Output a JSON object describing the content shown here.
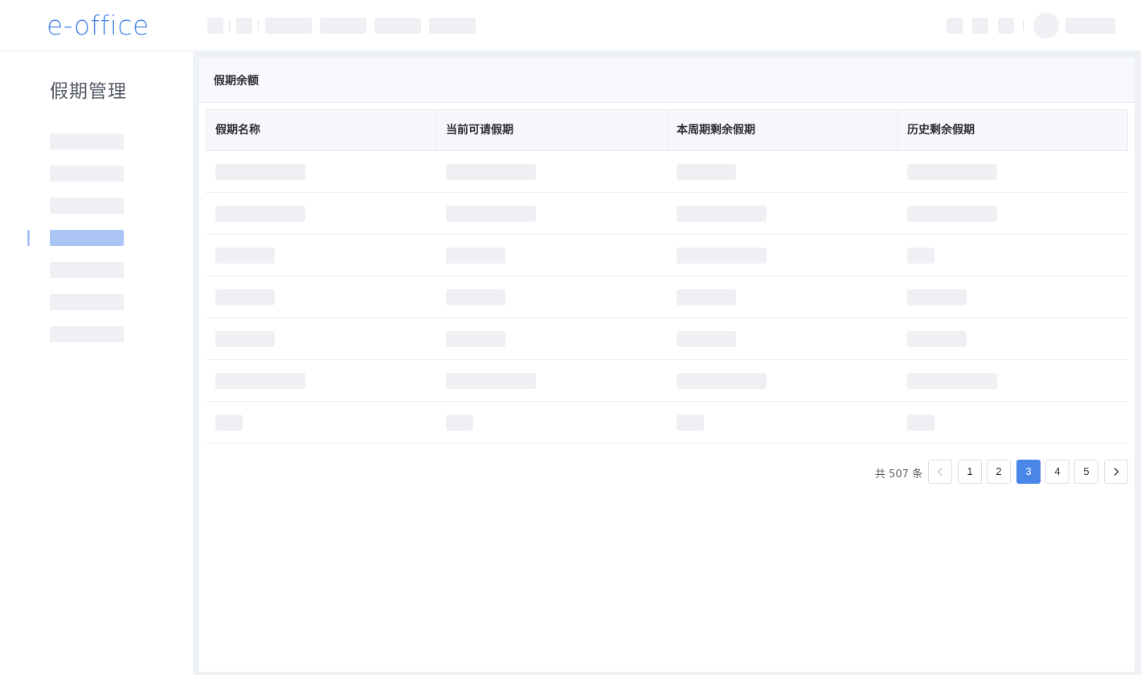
{
  "header": {
    "logo": "e-office"
  },
  "sidebar": {
    "title": "假期管理",
    "active_index": 3
  },
  "panel": {
    "title": "假期余额"
  },
  "table": {
    "columns": [
      "假期名称",
      "当前可请假期",
      "本周期剩余假期",
      "历史剩余假期"
    ]
  },
  "pagination": {
    "total_text": "共 507 条",
    "pages": [
      "1",
      "2",
      "3",
      "4",
      "5"
    ],
    "current_page": "3",
    "prev_icon": "chevron-left-icon",
    "next_icon": "chevron-right-icon"
  },
  "colors": {
    "accent": "#4a86e8",
    "active_nav": "#a9c4f5",
    "skeleton": "#eef0f3"
  }
}
